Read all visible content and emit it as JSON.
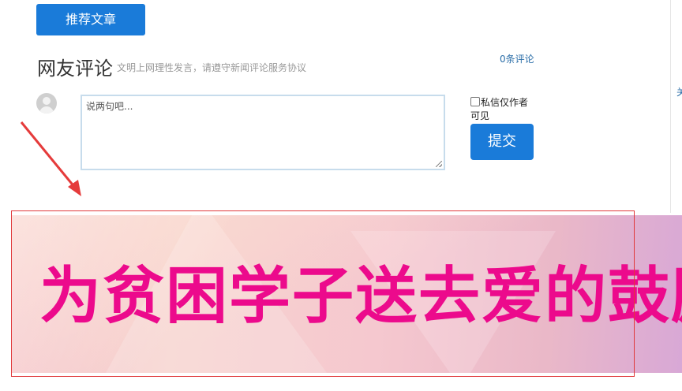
{
  "buttons": {
    "recommend": "推荐文章",
    "submit": "提交"
  },
  "comments": {
    "title": "网友评论",
    "note": "文明上网理性发言，请遵守新闻评论服务协议",
    "count": "0条评论",
    "placeholder": "说两句吧...",
    "private_label": "私信仅作者可见"
  },
  "banner": {
    "text": "为贫困学子送去爱的鼓励"
  },
  "edge": {
    "glyph": "关"
  },
  "colors": {
    "button_blue": "#1a7bd9",
    "banner_text": "#ec0a8c",
    "annotation_red": "#e0393b"
  },
  "icons": {
    "avatar": "default-user-avatar",
    "arrow": "red-annotation-arrow"
  }
}
